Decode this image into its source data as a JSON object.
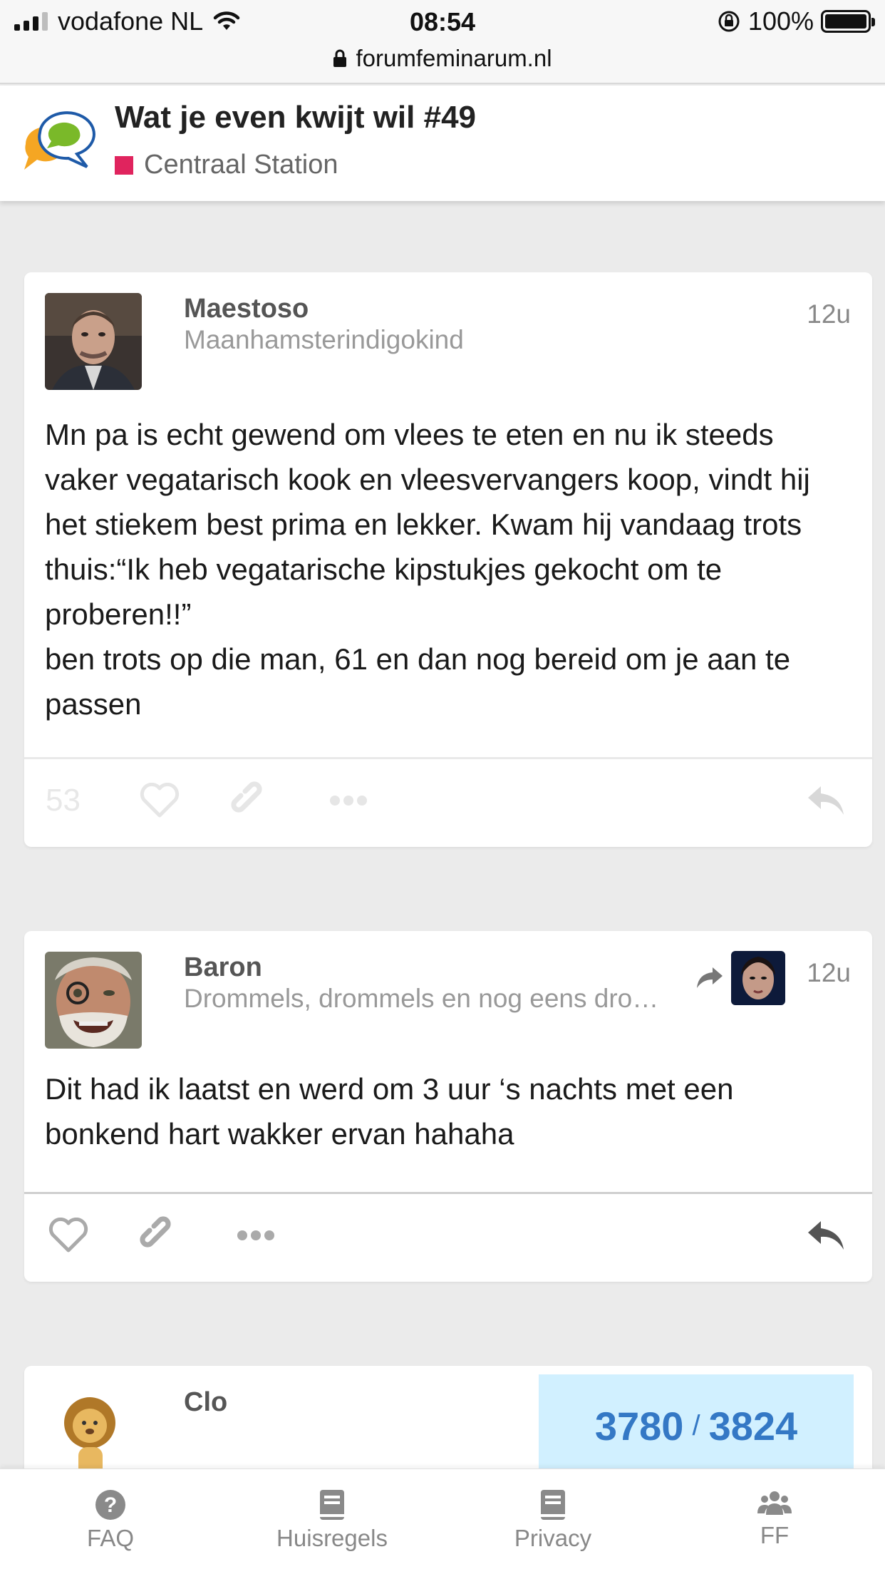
{
  "status_bar": {
    "carrier": "vodafone NL",
    "time": "08:54",
    "battery": "100%",
    "url": "forumfeminarum.nl"
  },
  "header": {
    "title": "Wat je even kwijt wil #49",
    "category": "Centraal Station",
    "category_color": "#e0245e"
  },
  "posts": [
    {
      "username": "Maestoso",
      "user_title": "Maanhamsterindigokind",
      "time": "12u",
      "body": [
        "Mn pa is echt gewend om vlees te eten en nu ik steeds vaker vegatarisch kook en vleesvervangers koop, vindt hij het stiekem best prima en lekker. Kwam hij vandaag trots thuis:“Ik heb vegatarische kipstukjes gekocht om te proberen!!”",
        "ben trots op die man, 61 en dan nog bereid om je aan te passen"
      ],
      "like_count": "53"
    },
    {
      "username": "Baron",
      "user_title": "Drommels, drommels en nog eens dro…",
      "time": "12u",
      "body": [
        "Dit had ik laatst en werd om 3 uur ‘s nachts met een bonkend hart wakker ervan hahaha"
      ]
    },
    {
      "username": "Clo"
    }
  ],
  "progress": {
    "current": "3780",
    "separator": "/",
    "total": "3824"
  },
  "bottom_nav": [
    {
      "label": "FAQ",
      "icon": "question-icon"
    },
    {
      "label": "Huisregels",
      "icon": "book-icon"
    },
    {
      "label": "Privacy",
      "icon": "book-icon"
    },
    {
      "label": "FF",
      "icon": "users-icon"
    }
  ]
}
